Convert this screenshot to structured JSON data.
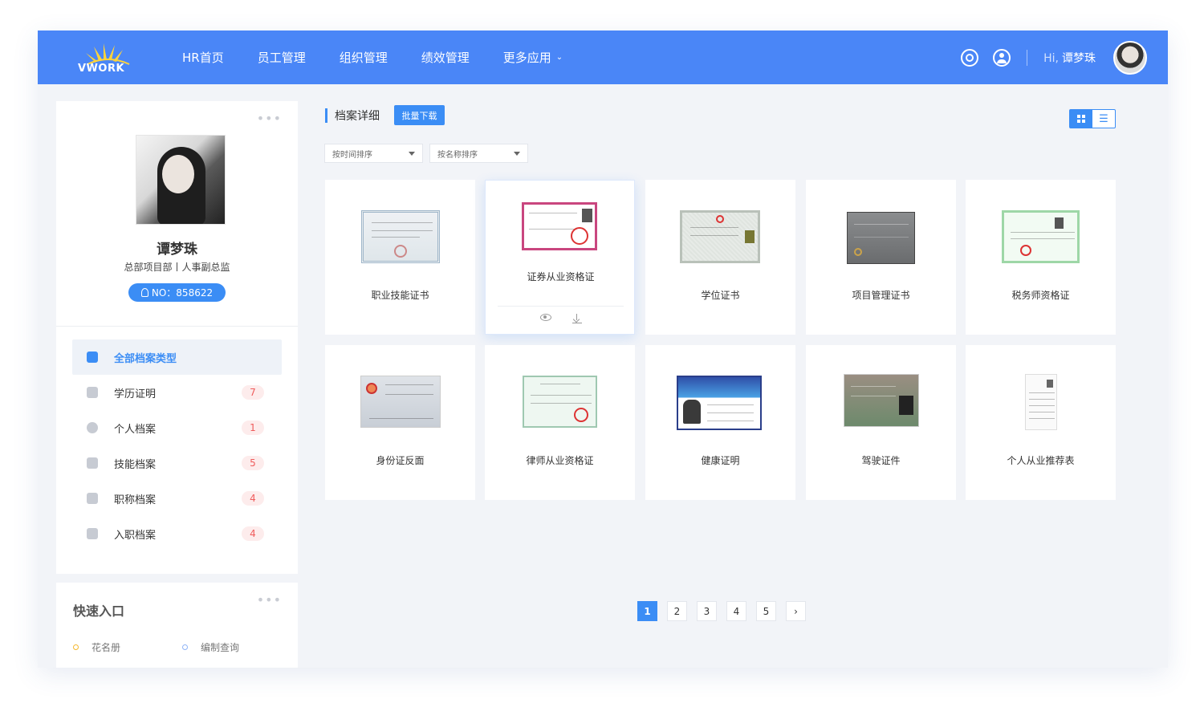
{
  "header": {
    "logo_text": "VWORK",
    "nav": [
      {
        "label": "HR首页"
      },
      {
        "label": "员工管理"
      },
      {
        "label": "组织管理"
      },
      {
        "label": "绩效管理"
      },
      {
        "label": "更多应用",
        "has_dropdown": true
      }
    ],
    "greeting_hi": "Hi,",
    "user_name": "谭梦珠",
    "icons": [
      "settings-icon",
      "user-circle-icon",
      "avatar"
    ]
  },
  "profile": {
    "name": "谭梦珠",
    "department": "总部项目部丨人事副总监",
    "employee_no": "NO：858622"
  },
  "categories": [
    {
      "label": "全部档案类型",
      "count": "",
      "active": true
    },
    {
      "label": "学历证明",
      "count": "7"
    },
    {
      "label": "个人档案",
      "count": "1"
    },
    {
      "label": "技能档案",
      "count": "5"
    },
    {
      "label": "职称档案",
      "count": "4"
    },
    {
      "label": "入职档案",
      "count": "4"
    }
  ],
  "quick_access": {
    "title": "快速入口",
    "items": [
      {
        "label": "花名册"
      },
      {
        "label": "编制查询"
      }
    ]
  },
  "main": {
    "title": "档案详细",
    "batch_download": "批量下载",
    "sort_by_time": "按时间排序",
    "sort_by_name": "按名称排序"
  },
  "documents": [
    {
      "label": "职业技能证书"
    },
    {
      "label": "证券从业资格证",
      "hovered": true
    },
    {
      "label": "学位证书"
    },
    {
      "label": "项目管理证书"
    },
    {
      "label": "税务师资格证"
    },
    {
      "label": "身份证反面"
    },
    {
      "label": "律师从业资格证"
    },
    {
      "label": "健康证明"
    },
    {
      "label": "驾驶证件"
    },
    {
      "label": "个人从业推荐表"
    }
  ],
  "pagination": {
    "pages": [
      "1",
      "2",
      "3",
      "4",
      "5"
    ],
    "current": "1",
    "next": "›"
  },
  "colors": {
    "primary": "#4a86f7",
    "accent": "#3b8df5",
    "badge_bg": "#fdecec",
    "badge_text": "#ef5c5c"
  }
}
